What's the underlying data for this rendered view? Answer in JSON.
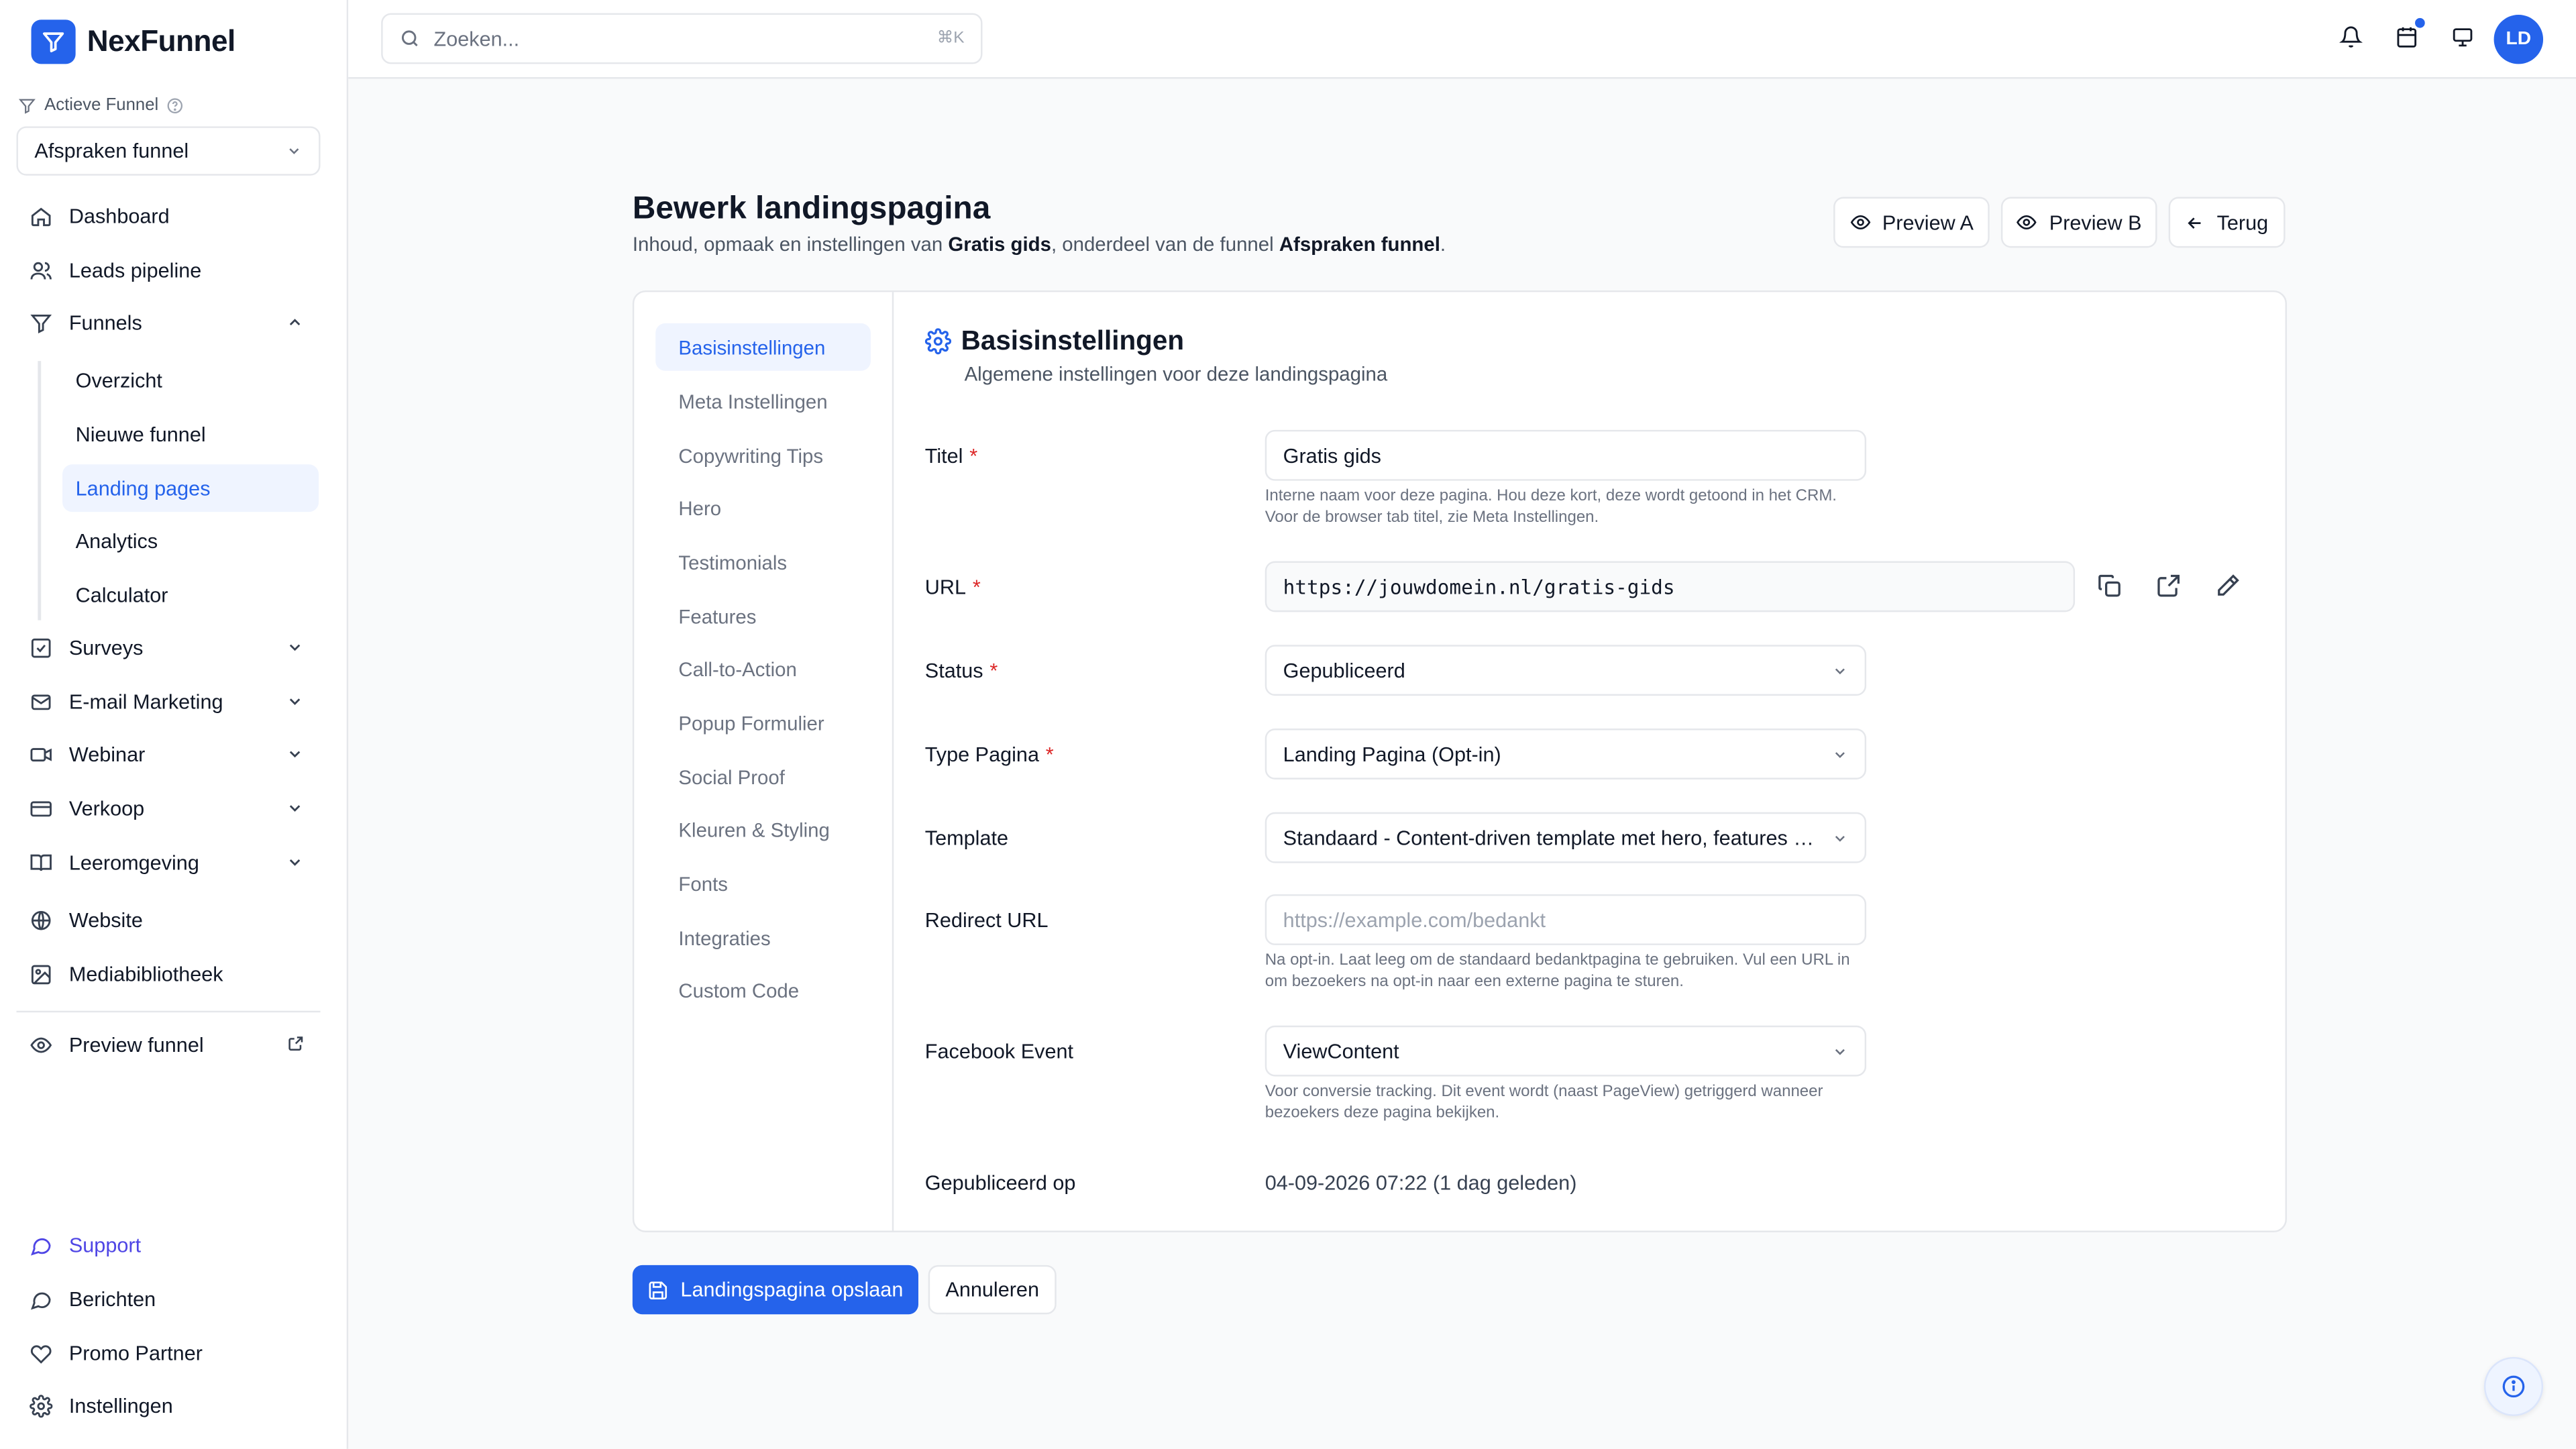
{
  "app": {
    "name": "NexFunnel",
    "brand_color": "#2563eb"
  },
  "sidebar": {
    "active_funnel_label": "Actieve Funnel",
    "active_funnel_value": "Afspraken funnel",
    "items": [
      {
        "label": "Dashboard",
        "icon": "home-icon"
      },
      {
        "label": "Leads pipeline",
        "icon": "users-icon"
      },
      {
        "label": "Funnels",
        "icon": "funnel-icon",
        "expanded": true
      },
      {
        "label": "Surveys",
        "icon": "checkbox-icon"
      },
      {
        "label": "E-mail Marketing",
        "icon": "mail-icon"
      },
      {
        "label": "Webinar",
        "icon": "video-icon"
      },
      {
        "label": "Verkoop",
        "icon": "credit-card-icon"
      },
      {
        "label": "Leeromgeving",
        "icon": "book-icon"
      },
      {
        "label": "Website",
        "icon": "globe-icon"
      },
      {
        "label": "Mediabibliotheek",
        "icon": "image-icon"
      },
      {
        "label": "Preview funnel",
        "icon": "eye-icon"
      }
    ],
    "funnel_subitems": [
      "Overzicht",
      "Nieuwe funnel",
      "Landing pages",
      "Analytics",
      "Calculator"
    ],
    "active_subitem": "Landing pages",
    "bottom": [
      {
        "label": "Support",
        "icon": "chat-icon",
        "color": "#4f46e5"
      },
      {
        "label": "Berichten",
        "icon": "message-icon"
      },
      {
        "label": "Promo Partner",
        "icon": "heart-icon"
      },
      {
        "label": "Instellingen",
        "icon": "gear-icon"
      }
    ]
  },
  "topbar": {
    "search_placeholder": "Zoeken...",
    "search_shortcut": "⌘K",
    "avatar_initials": "LD"
  },
  "page": {
    "title": "Bewerk landingspagina",
    "subtitle_prefix": "Inhoud, opmaak en instellingen van ",
    "subtitle_page": "Gratis gids",
    "subtitle_mid": ", onderdeel van de funnel ",
    "subtitle_funnel": "Afspraken funnel",
    "subtitle_end": ".",
    "buttons": {
      "preview_a": "Preview A",
      "preview_b": "Preview B",
      "back": "Terug"
    }
  },
  "settings_nav": {
    "items": [
      "Basisinstellingen",
      "Meta Instellingen",
      "Copywriting Tips",
      "Hero",
      "Testimonials",
      "Features",
      "Call-to-Action",
      "Popup Formulier",
      "Social Proof",
      "Kleuren & Styling",
      "Fonts",
      "Integraties",
      "Custom Code"
    ],
    "active": "Basisinstellingen"
  },
  "section": {
    "title": "Basisinstellingen",
    "subtitle": "Algemene instellingen voor deze landingspagina"
  },
  "form": {
    "titel": {
      "label": "Titel",
      "value": "Gratis gids",
      "help": "Interne naam voor deze pagina. Hou deze kort, deze wordt getoond in het CRM. Voor de browser tab titel, zie Meta Instellingen."
    },
    "url": {
      "label": "URL",
      "value": "https://jouwdomein.nl/gratis-gids"
    },
    "status": {
      "label": "Status",
      "value": "Gepubliceerd"
    },
    "type": {
      "label": "Type Pagina",
      "value": "Landing Pagina (Opt-in)"
    },
    "template": {
      "label": "Template",
      "value": "Standaard - Content-driven template met hero, features en ..."
    },
    "redirect": {
      "label": "Redirect URL",
      "placeholder": "https://example.com/bedankt",
      "help": "Na opt-in. Laat leeg om de standaard bedanktpagina te gebruiken. Vul een URL in om bezoekers na opt-in naar een externe pagina te sturen."
    },
    "fb_event": {
      "label": "Facebook Event",
      "value": "ViewContent",
      "help": "Voor conversie tracking. Dit event wordt (naast PageView) getriggerd wanneer bezoekers deze pagina bekijken."
    },
    "published": {
      "label": "Gepubliceerd op",
      "value": "04-09-2026 07:22 (1 dag geleden)"
    },
    "required_mark": "*"
  },
  "actions": {
    "save": "Landingspagina opslaan",
    "cancel": "Annuleren"
  }
}
